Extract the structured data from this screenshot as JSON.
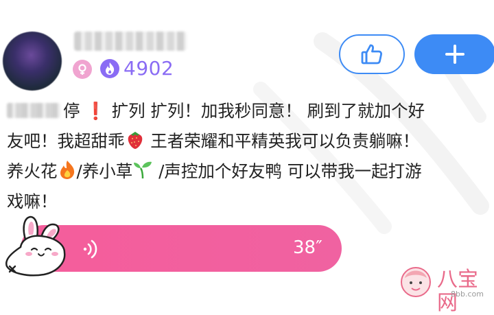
{
  "header": {
    "score": "4902",
    "like_icon": "thumbs-up-icon",
    "add_icon": "plus-icon"
  },
  "post": {
    "line1_text": "停",
    "line1_rest": "扩列 扩列！加我秒同意！ 刷到了就加个好",
    "line2_a": "友吧！我超甜乖",
    "line2_b": "王者荣耀和平精英我可以负责躺嘛！",
    "line3_a": "养火花",
    "line3_b": "/养小草",
    "line3_c": "/声控加个好友鸭 可以带我一起打游",
    "line4": "戏嘛！",
    "exclamation": "❗"
  },
  "voice": {
    "duration": "38″",
    "wave_icon": "sound-wave-icon"
  },
  "watermark": {
    "site_name": "八宝网",
    "site_url": "8bb.com"
  },
  "colors": {
    "accent_blue": "#3d8bf5",
    "score_purple": "#8a6cf4",
    "voice_pink": "#f55d9b"
  }
}
